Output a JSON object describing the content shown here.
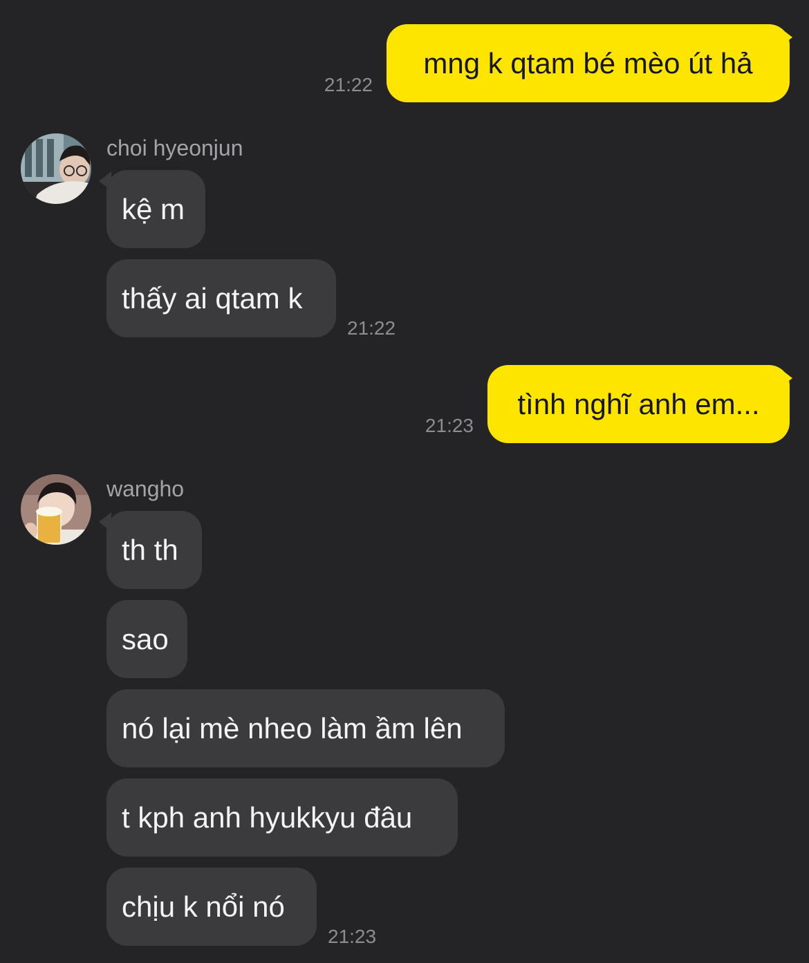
{
  "colors": {
    "background": "#242426",
    "sent_bubble": "#fee500",
    "received_bubble": "#3b3b3d",
    "timestamp": "#8d8d90",
    "name": "#a4a4a8"
  },
  "messages": {
    "sent1": {
      "text": "mng k qtam bé mèo út hả",
      "time": "21:22"
    },
    "group1": {
      "sender": "choi hyeonjun",
      "avatar_icon": "user-avatar-icon",
      "bubbles": [
        "kệ m",
        "thấy ai qtam k"
      ],
      "time": "21:22"
    },
    "sent2": {
      "text": "tình nghĩ anh em...",
      "time": "21:23"
    },
    "group2": {
      "sender": "wangho",
      "avatar_icon": "user-avatar-icon",
      "bubbles": [
        "th th",
        "sao",
        "nó lại mè nheo làm ầm lên",
        "t kph anh hyukkyu đâu",
        "chịu k nổi nó"
      ],
      "time": "21:23"
    }
  }
}
